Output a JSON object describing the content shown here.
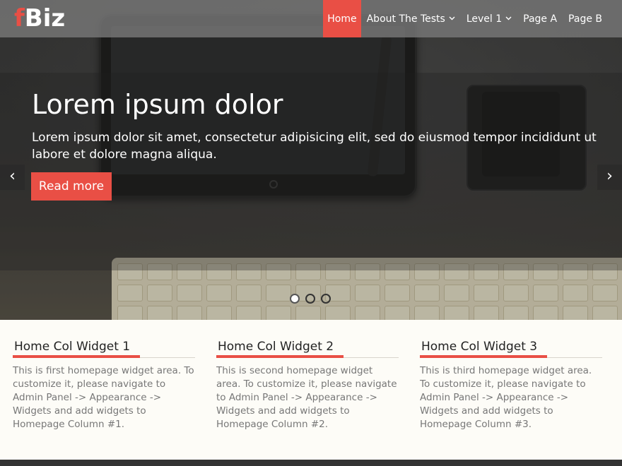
{
  "header": {
    "logo_accent": "f",
    "logo_rest": "Biz",
    "nav": [
      {
        "label": "Home",
        "active": true,
        "has_dropdown": false
      },
      {
        "label": "About The Tests",
        "active": false,
        "has_dropdown": true
      },
      {
        "label": "Level 1",
        "active": false,
        "has_dropdown": true
      },
      {
        "label": "Page A",
        "active": false,
        "has_dropdown": false
      },
      {
        "label": "Page B",
        "active": false,
        "has_dropdown": false
      }
    ],
    "chevron": "⌄"
  },
  "slider": {
    "title": "Lorem ipsum dolor",
    "text": "Lorem ipsum dolor sit amet, consectetur adipisicing elit, sed do eiusmod tempor incididunt ut labore et dolore magna aliqua.",
    "button_label": "Read more",
    "prev_icon": "‹",
    "next_icon": "›",
    "slide_count": 3,
    "active_slide": 1
  },
  "widgets": [
    {
      "title": "Home Col Widget 1",
      "text": "This is first homepage widget area. To customize it, please navigate to Admin Panel -> Appearance -> Widgets and add widgets to Homepage Column #1."
    },
    {
      "title": "Home Col Widget 2",
      "text": "This is second homepage widget area. To customize it, please navigate to Admin Panel -> Appearance -> Widgets and add widgets to Homepage Column #2."
    },
    {
      "title": "Home Col Widget 3",
      "text": "This is third homepage widget area. To customize it, please navigate to Admin Panel -> Appearance -> Widgets and add widgets to Homepage Column #3."
    }
  ],
  "colors": {
    "accent": "#e94f45",
    "header_bg": "#7a7a7a",
    "page_bg": "#fdfcf7"
  }
}
